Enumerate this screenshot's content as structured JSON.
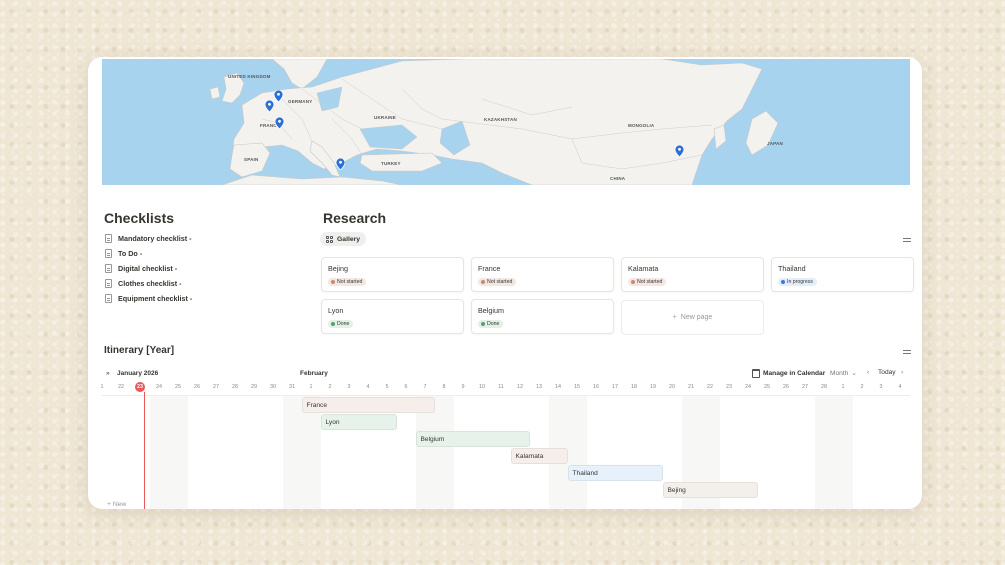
{
  "map": {
    "labels": [
      "UNITED KINGDOM",
      "GERMANY",
      "UKRAINE",
      "KAZAKHSTAN",
      "MONGOLIA",
      "FRANCE",
      "SPAIN",
      "TURKEY",
      "CHINA",
      "JAPAN"
    ],
    "colors": {
      "water": "#a8d3ef",
      "land": "#f3f2ef",
      "border": "#c9c7c3"
    }
  },
  "checklists": {
    "title": "Checklists",
    "items": [
      "Mandatory checklist -",
      "To Do -",
      "Digital checklist -",
      "Clothes checklist -",
      "Equipment checklist -"
    ]
  },
  "research": {
    "title": "Research",
    "view_tab": "Gallery",
    "cards": [
      {
        "name": "Bejing",
        "status": "Not started"
      },
      {
        "name": "France",
        "status": "Not started"
      },
      {
        "name": "Kalamata",
        "status": "Not started"
      },
      {
        "name": "Thailand",
        "status": "In progress"
      },
      {
        "name": "Lyon",
        "status": "Done"
      },
      {
        "name": "Belgium",
        "status": "Done"
      }
    ],
    "new_page": "New page",
    "status_colors": {
      "Not started": {
        "bg": "#f4e7e2",
        "dot": "#c98a7a"
      },
      "In progress": {
        "bg": "#e3eefb",
        "dot": "#3a7bd5"
      },
      "Done": {
        "bg": "#e3f0e6",
        "dot": "#5a9e6f"
      }
    }
  },
  "itinerary": {
    "title": "Itinerary [Year]",
    "month_left": "January 2026",
    "month_right": "February",
    "manage_calendar": "Manage in Calendar",
    "range": "Month",
    "today": "Today",
    "days": [
      "1",
      "22",
      "23",
      "24",
      "25",
      "26",
      "27",
      "28",
      "29",
      "30",
      "31",
      "1",
      "2",
      "3",
      "4",
      "5",
      "6",
      "7",
      "8",
      "9",
      "10",
      "11",
      "12",
      "13",
      "14",
      "15",
      "16",
      "17",
      "18",
      "19",
      "20",
      "21",
      "22",
      "23",
      "24",
      "25",
      "26",
      "27",
      "28",
      "1",
      "2",
      "3",
      "4"
    ],
    "today_day": "23",
    "bars": [
      {
        "label": "France",
        "start": "Jan 31",
        "end": "Feb 7",
        "color": "#f5eeea"
      },
      {
        "label": "Lyon",
        "start": "Feb 2",
        "end": "Feb 5",
        "color": "#e6f2ea"
      },
      {
        "label": "Belgium",
        "start": "Feb 7",
        "end": "Feb 12",
        "color": "#e6f2ea"
      },
      {
        "label": "Kalamata",
        "start": "Feb 12",
        "end": "Feb 14",
        "color": "#f5eeea"
      },
      {
        "label": "Thailand",
        "start": "Feb 15",
        "end": "Feb 19",
        "color": "#e6f1fb"
      },
      {
        "label": "Bejing",
        "start": "Feb 20",
        "end": "Feb 24",
        "color": "#f3efea"
      }
    ],
    "new_label": "New"
  }
}
